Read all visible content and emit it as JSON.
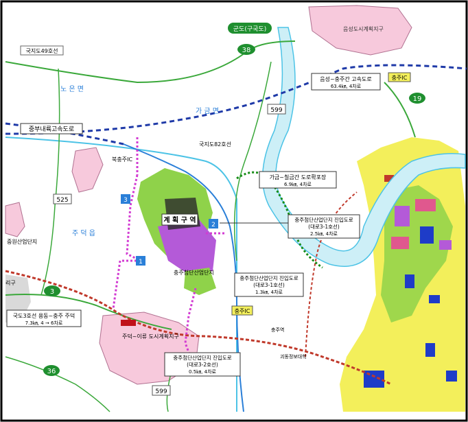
{
  "colors": {
    "land": "#ffffff",
    "river": "#4cc3e6",
    "river_fill": "#cdeff7",
    "expressway": "#1f3aa8",
    "national_road": "#3aa83a",
    "local_road": "#2f8f2f",
    "highway_blue": "#2a7fd8",
    "planned_magenta": "#d23ad2",
    "planned_green": "#168c16",
    "railway": "#c0392b",
    "urban_yellow": "#f3ef5b",
    "urban_green": "#8fd24a",
    "industrial_purple": "#b45ad8",
    "residential_pink": "#f4a9c8",
    "district_pink": "#f7c9dc"
  },
  "labels": {
    "gunsan_road": "군도(구국도)",
    "eumseong_plan": "음성도시계획지구",
    "route_49": "국지도49호선",
    "route_38": "38",
    "noeun": "노 은 면",
    "gageum": "가 금 면",
    "route_599_top": "599",
    "jungbu_expressway": "중부내륙고속도로",
    "eumseong_chungju_expressway": "음성~충주간 고속도로",
    "eumseong_chungju_spec": "63.4㎞, 4차로",
    "chungju_ic_top": "충주IC",
    "route_19": "19",
    "route_82": "국지도82호선",
    "bukchungju_ic": "북충주IC",
    "gageum_chilgeum_road": "가금~칠금간 도로확포장",
    "gageum_chilgeum_spec": "6.9㎞, 4차로",
    "route_525": "525",
    "site_name": "계 획 구 역",
    "marker_1": "1",
    "marker_2": "2",
    "marker_3": "3",
    "access_road_1": "충주첨단산업단지 진입도로",
    "access_road_1_sub": "(대로3-1호선)",
    "access_road_1_spec": "2.5㎞, 4차로",
    "jumdeok": "주 덕 읍",
    "jungwon_complex": "중원산업단지",
    "chungju_complex": "충주첨단산업단지",
    "access_road_2": "충주첨단산업단지 진입도로",
    "access_road_2_sub": "(대로3-1호선)",
    "access_road_2_spec": "1.3㎞, 4차로",
    "route_3": "3",
    "route_3_road": "국도3호선 용동~충주 주덕",
    "route_3_spec": "7.3㎞, 4 → 6차로",
    "chungju_ic": "충주IC",
    "jungju_station": "충주역",
    "jumdeok_plan": "주덕~이류 도시계획지구",
    "access_road_3": "충주첨단산업단지 진입도로",
    "access_road_3_sub": "(대로3-2호선)",
    "access_road_3_spec": "0.5㎞, 4차로",
    "route_36": "36",
    "route_599_bottom": "599",
    "chungju_bypass": "괴동정보대학",
    "edge_ri": "리구"
  }
}
